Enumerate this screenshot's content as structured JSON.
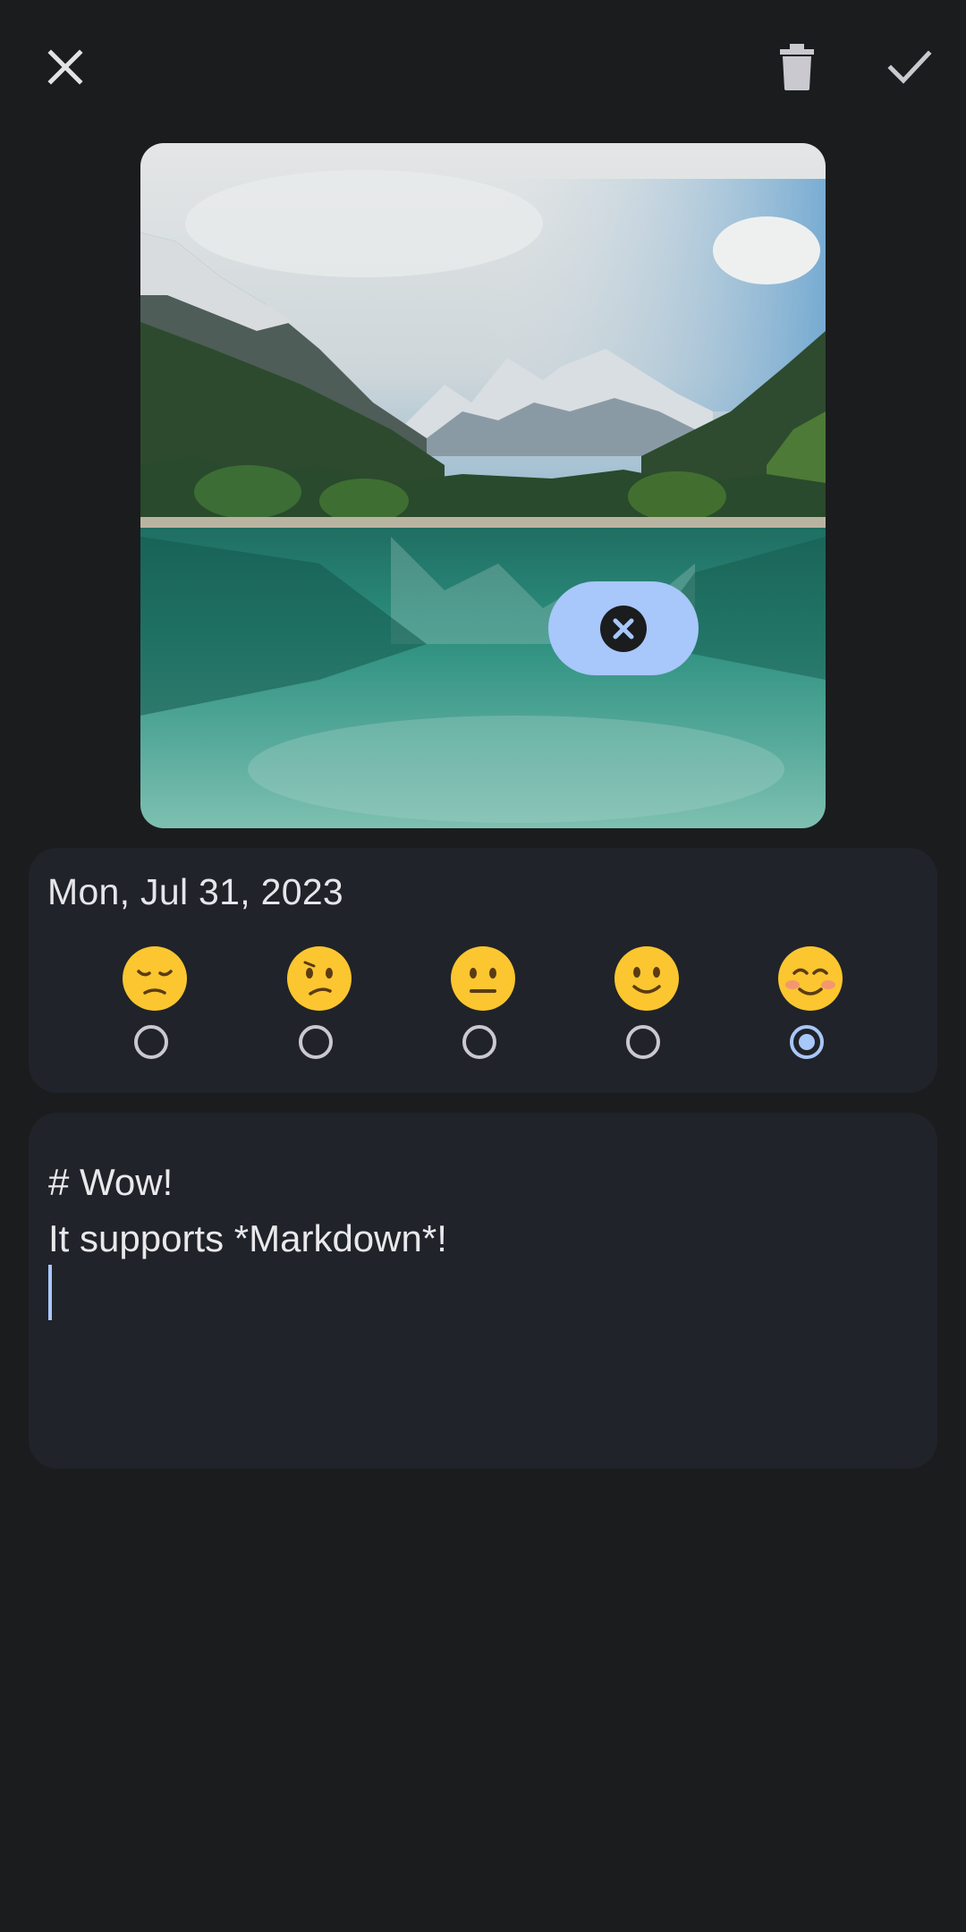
{
  "topbar": {
    "close_icon": "close-icon",
    "delete_icon": "trash-icon",
    "confirm_icon": "check-icon"
  },
  "photo": {
    "description_icon": "landscape-photo",
    "remove_icon": "remove-circle-icon"
  },
  "entry": {
    "date": "Mon, Jul 31, 2023",
    "moods": [
      {
        "icon": "pensive-face-icon",
        "selected": false
      },
      {
        "icon": "confused-face-icon",
        "selected": false
      },
      {
        "icon": "neutral-face-icon",
        "selected": false
      },
      {
        "icon": "slightly-smiling-face-icon",
        "selected": false
      },
      {
        "icon": "smiling-blushing-face-icon",
        "selected": true
      }
    ],
    "note_lines": [
      "# Wow!",
      "It supports *Markdown*!"
    ]
  },
  "colors": {
    "background": "#1b1c1e",
    "card": "#202329",
    "accent": "#a8c7fa",
    "icon": "#c9c9cf"
  }
}
